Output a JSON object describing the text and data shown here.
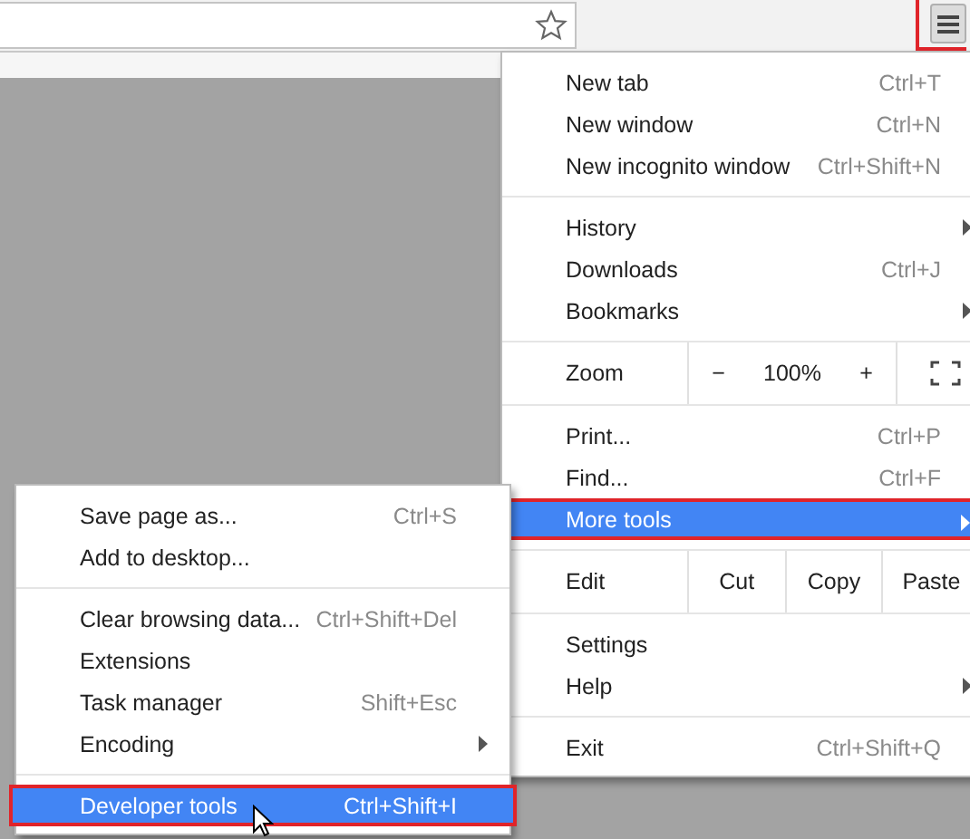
{
  "toolbar": {
    "menu_button": {
      "annotated": true
    }
  },
  "menu": {
    "sections": [
      [
        {
          "kind": "item",
          "label": "New tab",
          "shortcut": "Ctrl+T",
          "has_submenu": false,
          "hovered": false,
          "annotated": false
        },
        {
          "kind": "item",
          "label": "New window",
          "shortcut": "Ctrl+N",
          "has_submenu": false,
          "hovered": false,
          "annotated": false
        },
        {
          "kind": "item",
          "label": "New incognito window",
          "shortcut": "Ctrl+Shift+N",
          "has_submenu": false,
          "hovered": false,
          "annotated": false
        }
      ],
      [
        {
          "kind": "item",
          "label": "History",
          "has_submenu": true,
          "hovered": false,
          "annotated": false
        },
        {
          "kind": "item",
          "label": "Downloads",
          "shortcut": "Ctrl+J",
          "has_submenu": false,
          "hovered": false,
          "annotated": false
        },
        {
          "kind": "item",
          "label": "Bookmarks",
          "has_submenu": true,
          "hovered": false,
          "annotated": false
        }
      ],
      [
        {
          "kind": "zoom",
          "label": "Zoom",
          "minus": "−",
          "value": "100%",
          "plus": "+"
        }
      ],
      [
        {
          "kind": "item",
          "label": "Print...",
          "shortcut": "Ctrl+P",
          "has_submenu": false,
          "hovered": false,
          "annotated": false
        },
        {
          "kind": "item",
          "label": "Find...",
          "shortcut": "Ctrl+F",
          "has_submenu": false,
          "hovered": false,
          "annotated": false
        },
        {
          "kind": "item",
          "label": "More tools",
          "has_submenu": true,
          "hovered": true,
          "annotated": true
        }
      ],
      [
        {
          "kind": "edit",
          "label": "Edit",
          "buttons": [
            "Cut",
            "Copy",
            "Paste"
          ]
        }
      ],
      [
        {
          "kind": "item",
          "label": "Settings",
          "has_submenu": false,
          "hovered": false,
          "annotated": false
        },
        {
          "kind": "item",
          "label": "Help",
          "has_submenu": true,
          "hovered": false,
          "annotated": false
        }
      ],
      [
        {
          "kind": "item",
          "label": "Exit",
          "shortcut": "Ctrl+Shift+Q",
          "has_submenu": false,
          "hovered": false,
          "annotated": false
        }
      ]
    ]
  },
  "submenu": {
    "sections": [
      [
        {
          "kind": "item",
          "label": "Save page as...",
          "shortcut": "Ctrl+S",
          "has_submenu": false,
          "hovered": false,
          "annotated": false
        },
        {
          "kind": "item",
          "label": "Add to desktop...",
          "has_submenu": false,
          "hovered": false,
          "annotated": false
        }
      ],
      [
        {
          "kind": "item",
          "label": "Clear browsing data...",
          "shortcut": "Ctrl+Shift+Del",
          "has_submenu": false,
          "hovered": false,
          "annotated": false
        },
        {
          "kind": "item",
          "label": "Extensions",
          "has_submenu": false,
          "hovered": false,
          "annotated": false
        },
        {
          "kind": "item",
          "label": "Task manager",
          "shortcut": "Shift+Esc",
          "has_submenu": false,
          "hovered": false,
          "annotated": false
        },
        {
          "kind": "item",
          "label": "Encoding",
          "has_submenu": true,
          "hovered": false,
          "annotated": false
        }
      ],
      [
        {
          "kind": "item",
          "label": "Developer tools",
          "shortcut": "Ctrl+Shift+I",
          "has_submenu": false,
          "hovered": true,
          "annotated": true,
          "cursor": true
        }
      ]
    ]
  }
}
